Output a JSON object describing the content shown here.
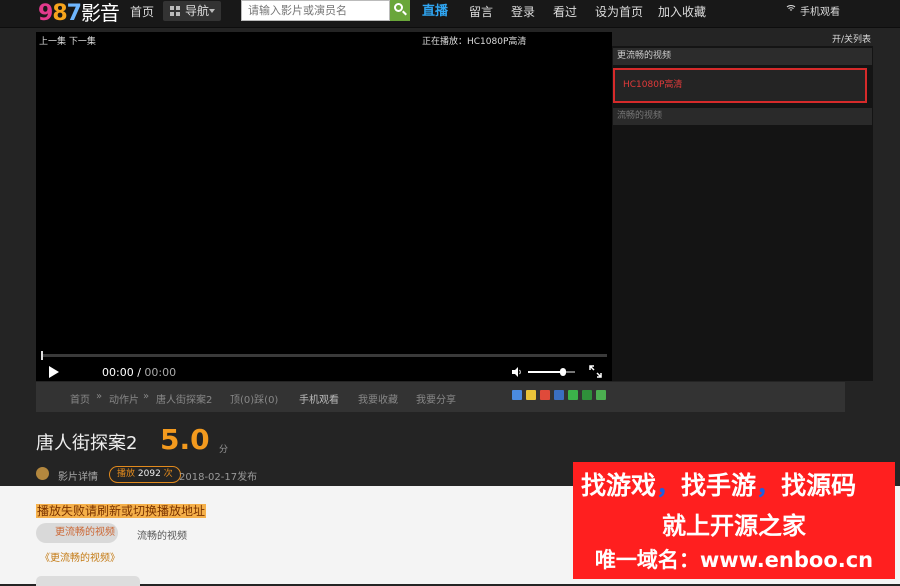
{
  "header": {
    "logo": {
      "num1": "9",
      "num2": "8",
      "num3": "7",
      "cn": "影音"
    },
    "nav_home": "首页",
    "nav_guide": "导航",
    "search_placeholder": "请输入影片或演员名",
    "nav_live": "直播",
    "nav_message": "留言",
    "nav_login": "登录",
    "nav_watched": "看过",
    "nav_set_home": "设为首页",
    "nav_favorite": "加入收藏",
    "mobile_watch": "手机观看"
  },
  "player": {
    "prev_next": "上一集 下一集",
    "now_playing": "正在播放：HC1080P高清",
    "current_time": "00:00",
    "separator": " / ",
    "duration": "00:00",
    "progress": 0,
    "volume": 0.75
  },
  "playlist": {
    "toggle": "开/关列表",
    "header": "更流畅的视频",
    "source": "HC1080P高清",
    "header2": "流畅的视频"
  },
  "breadcrumb": {
    "home": "首页",
    "sep1": "»",
    "category": "动作片",
    "sep2": "»",
    "current": "唐人街探案2",
    "votes": "顶(0)踩(0)",
    "mobile": "手机观看",
    "favorite": "我要收藏",
    "share": "我要分享"
  },
  "movie": {
    "title": "唐人街探案2",
    "score": "5.0",
    "score_unit": "分",
    "details": "影片详情",
    "plays_label": "播放",
    "plays_count": "2092",
    "plays_unit": "次",
    "date": "2018-02-17发布"
  },
  "lower": {
    "fail_notice": "播放失败请刷新或切换播放地址",
    "tab_smooth_plus": "更流畅的视频",
    "tab_smooth": "流畅的视频",
    "more_link": "《更流畅的视频》"
  },
  "ad": {
    "line1_a": "找游戏",
    "line1_b": "，",
    "line1_c": "找手游",
    "line1_d": "，",
    "line1_e": "找源码",
    "line2": "就上开源之家",
    "line3": "唯一域名：www.enboo.cn"
  },
  "share_icons": [
    "qzone-icon",
    "tencent-weibo-icon",
    "sina-weibo-icon",
    "renren-icon",
    "wechat-icon",
    "douban-icon",
    "kaixin-icon"
  ],
  "colors": {
    "accent": "#f39a1e",
    "live": "#2fa5f2",
    "source_border": "#d62a2a"
  }
}
